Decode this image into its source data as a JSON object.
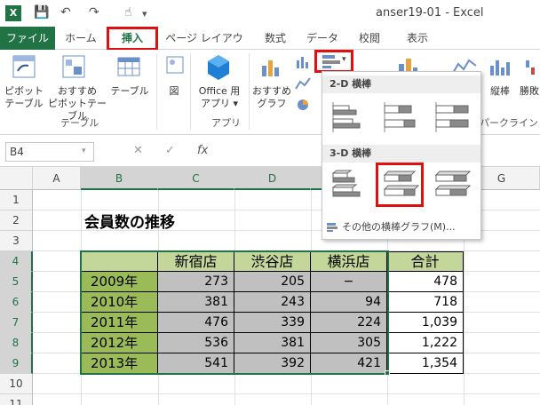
{
  "app": {
    "title": "anser19-01 - Excel",
    "logo": "X",
    "qa_save": "💾",
    "qa_undo": "↶",
    "qa_redo": "↷",
    "qa_touch": "☝",
    "qa_more": "▾"
  },
  "tabs": [
    {
      "label": "ファイル"
    },
    {
      "label": "ホーム"
    },
    {
      "label": "挿入"
    },
    {
      "label": "ページ レイアウト"
    },
    {
      "label": "数式"
    },
    {
      "label": "データ"
    },
    {
      "label": "校閲"
    },
    {
      "label": "表示"
    }
  ],
  "ribbon": {
    "pivot_l1": "ピボット",
    "pivot_l2": "テーブル",
    "rec_pivot_l1": "おすすめ",
    "rec_pivot_l2": "ピボットテーブル",
    "table": "テーブル",
    "table_group": "テーブル",
    "figure": "図",
    "office_app_l1": "Office 用",
    "office_app_l2": "アプリ ▾",
    "app_group": "アプリ",
    "rec_chart_l1": "おすすめ",
    "rec_chart_l2": "グラフ",
    "vertical": "縦棒",
    "winloss": "勝敗",
    "sparkline_group": "パークライン"
  },
  "formula_bar": {
    "name_box": "B4",
    "cancel": "✕",
    "enter": "✓",
    "fx": "fx"
  },
  "columns": [
    "A",
    "B",
    "C",
    "D",
    "E",
    "F",
    "G"
  ],
  "rows": [
    "1",
    "2",
    "3",
    "4",
    "5",
    "6",
    "7",
    "8",
    "9",
    "10",
    "11"
  ],
  "sheet": {
    "title": "会員数の推移",
    "headers": [
      "新宿店",
      "渋谷店",
      "横浜店",
      "合計"
    ],
    "data": [
      {
        "year": "2009年",
        "values": [
          "273",
          "205",
          "−"
        ],
        "total": "478"
      },
      {
        "year": "2010年",
        "values": [
          "381",
          "243",
          "94"
        ],
        "total": "718"
      },
      {
        "year": "2011年",
        "values": [
          "476",
          "339",
          "224"
        ],
        "total": "1,039"
      },
      {
        "year": "2012年",
        "values": [
          "536",
          "381",
          "305"
        ],
        "total": "1,222"
      },
      {
        "year": "2013年",
        "values": [
          "541",
          "392",
          "421"
        ],
        "total": "1,354"
      }
    ]
  },
  "dropdown": {
    "section_2d": "2-D 横棒",
    "section_3d": "3-D 横棒",
    "more": "その他の横棒グラフ(M)..."
  },
  "colors": {
    "excel_green": "#217346",
    "highlight_red": "#e01010",
    "header_green": "#c4d79b",
    "year_green": "#9bbb59",
    "value_gray": "#c0c0c0"
  }
}
